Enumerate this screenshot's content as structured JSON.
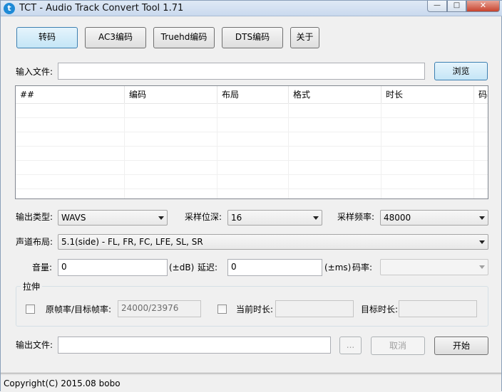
{
  "window": {
    "title": "TCT - Audio Track Convert Tool 1.71",
    "controls": {
      "minimize": "—",
      "maximize": "□",
      "close": "✕"
    }
  },
  "tabs": [
    "转码",
    "AC3编码",
    "Truehd编码",
    "DTS编码",
    "关于"
  ],
  "input": {
    "label": "输入文件:",
    "value": "",
    "browse": "浏览"
  },
  "table": {
    "columns": [
      "##",
      "编码",
      "布局",
      "格式",
      "时长",
      "码率"
    ],
    "rows": []
  },
  "output_settings": {
    "type_label": "输出类型:",
    "type_value": "WAVS",
    "bitdepth_label": "采样位深:",
    "bitdepth_value": "16",
    "samplerate_label": "采样频率:",
    "samplerate_value": "48000",
    "layout_label": "声道布局:",
    "layout_value": "5.1(side) - FL, FR, FC, LFE, SL, SR",
    "volume_label": "音量:",
    "volume_value": "0",
    "volume_unit": "(±dB)",
    "delay_label": "延迟:",
    "delay_value": "0",
    "delay_unit": "(±ms)",
    "bitrate_label": "码率:",
    "bitrate_value": ""
  },
  "stretch": {
    "group_label": "拉伸",
    "framerate_label": "原帧率/目标帧率:",
    "framerate_value": "24000/23976",
    "current_duration_label": "当前时长:",
    "current_duration_value": "",
    "target_duration_label": "目标时长:",
    "target_duration_value": ""
  },
  "output": {
    "label": "输出文件:",
    "value": "",
    "browse": "...",
    "cancel": "取消",
    "start": "开始"
  },
  "status": {
    "copyright": "Copyright(C) 2015.08 bobo"
  }
}
